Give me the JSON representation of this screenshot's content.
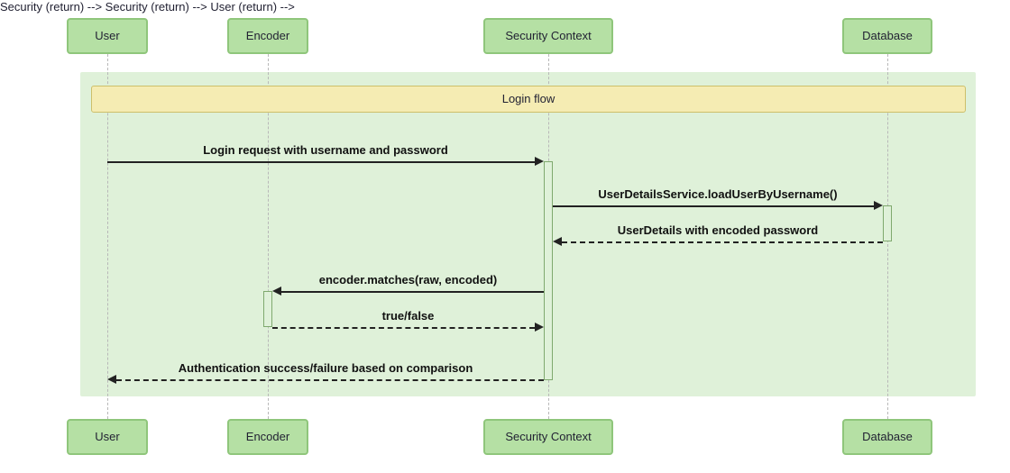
{
  "actors": {
    "user": "User",
    "encoder": "Encoder",
    "security": "Security Context",
    "database": "Database"
  },
  "note": "Login flow",
  "messages": {
    "m1": "Login request with username and password",
    "m2": "UserDetailsService.loadUserByUsername()",
    "m3": "UserDetails with encoded password",
    "m4": "encoder.matches(raw, encoded)",
    "m5": "true/false",
    "m6": "Authentication success/failure based on comparison"
  },
  "colors": {
    "actorFill": "#b5e0a4",
    "actorStroke": "#8fc67b",
    "frameFill": "#dff1d9",
    "noteFill": "#f5ecb3",
    "noteStroke": "#cdbf6a",
    "line": "#222"
  }
}
